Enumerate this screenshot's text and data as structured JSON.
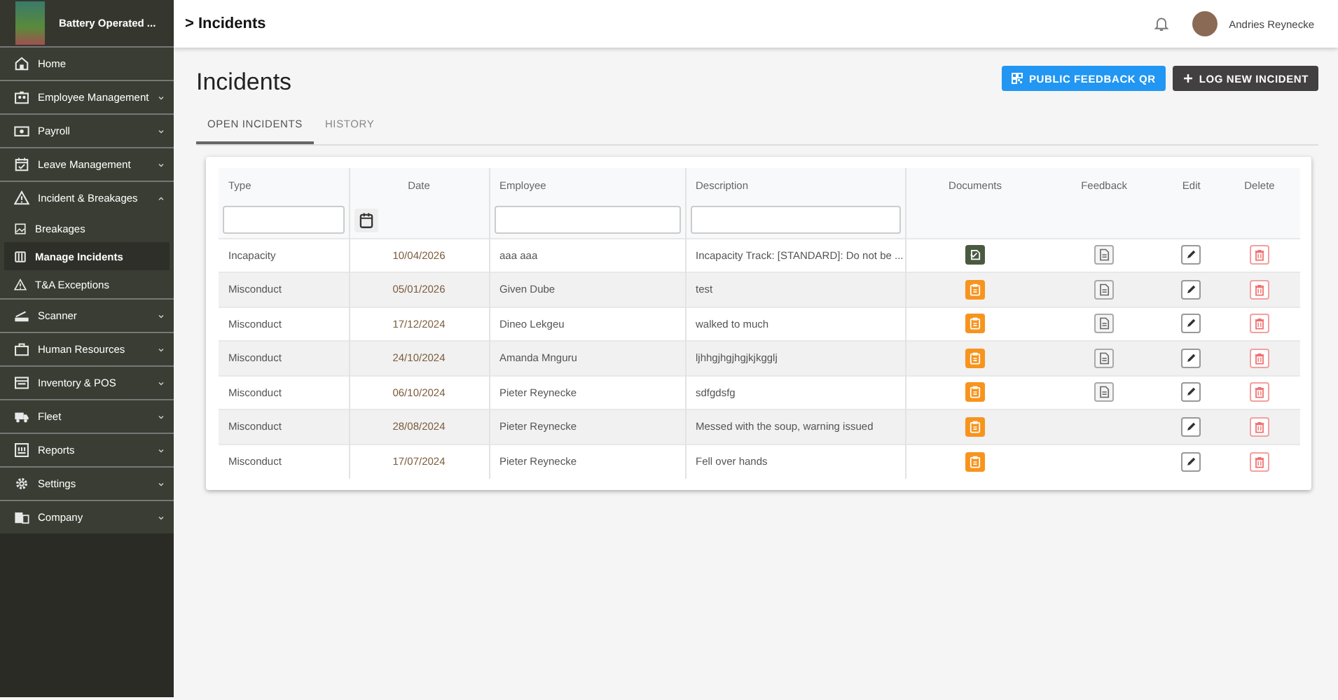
{
  "sidebar": {
    "company": "Battery Operated ...",
    "items": [
      {
        "label": "Home",
        "expandable": false,
        "selected": false
      },
      {
        "label": "Employee Management",
        "expandable": true,
        "expanded": false,
        "selected": false
      },
      {
        "label": "Payroll",
        "expandable": true,
        "expanded": false,
        "selected": false
      },
      {
        "label": "Leave Management",
        "expandable": true,
        "expanded": false,
        "selected": false
      },
      {
        "label": "Incident & Breakages",
        "expandable": true,
        "expanded": true,
        "selected": false,
        "children": [
          {
            "label": "Breakages",
            "selected": false
          },
          {
            "label": "Manage Incidents",
            "selected": true
          },
          {
            "label": "T&A Exceptions",
            "selected": false
          }
        ]
      },
      {
        "label": "Scanner",
        "expandable": true,
        "expanded": false,
        "selected": false
      },
      {
        "label": "Human Resources",
        "expandable": true,
        "expanded": false,
        "selected": false
      },
      {
        "label": "Inventory & POS",
        "expandable": true,
        "expanded": false,
        "selected": false
      },
      {
        "label": "Fleet",
        "expandable": true,
        "expanded": false,
        "selected": false
      },
      {
        "label": "Reports",
        "expandable": true,
        "expanded": false,
        "selected": false
      },
      {
        "label": "Settings",
        "expandable": true,
        "expanded": false,
        "selected": false
      },
      {
        "label": "Company",
        "expandable": true,
        "expanded": false,
        "selected": false
      }
    ]
  },
  "header": {
    "breadcrumb": "> Incidents",
    "user": "Andries Reynecke"
  },
  "page": {
    "title": "Incidents",
    "buttons": [
      {
        "label": "PUBLIC FEEDBACK QR",
        "kind": "qr"
      },
      {
        "label": "LOG NEW INCIDENT",
        "kind": "add"
      }
    ],
    "tabs": [
      {
        "label": "OPEN INCIDENTS",
        "selected": true
      },
      {
        "label": "HISTORY",
        "selected": false
      }
    ]
  },
  "table": {
    "columns": [
      "Type",
      "Date",
      "Employee",
      "Description",
      "Documents",
      "Feedback",
      "Edit",
      "Delete"
    ],
    "rows": [
      {
        "type": "Incapacity",
        "date": "10/04/2026",
        "employee": "aaa aaa",
        "description": "Incapacity Track: [STANDARD]: Do not be ...",
        "kind": "generated",
        "has_feedback": true
      },
      {
        "type": "Misconduct",
        "date": "05/01/2026",
        "employee": "Given Dube",
        "description": "test",
        "kind": "upload",
        "has_feedback": true
      },
      {
        "type": "Misconduct",
        "date": "17/12/2024",
        "employee": "Dineo Lekgeu",
        "description": "walked to much",
        "kind": "upload",
        "has_feedback": true
      },
      {
        "type": "Misconduct",
        "date": "24/10/2024",
        "employee": "Amanda Mnguru",
        "description": "ljhhgjhgjhgjkjkgglj",
        "kind": "upload",
        "has_feedback": true
      },
      {
        "type": "Misconduct",
        "date": "06/10/2024",
        "employee": "Pieter Reynecke",
        "description": "sdfgdsfg",
        "kind": "upload",
        "has_feedback": true
      },
      {
        "type": "Misconduct",
        "date": "28/08/2024",
        "employee": "Pieter Reynecke",
        "description": "Messed with the soup, warning issued",
        "kind": "upload",
        "has_feedback": false
      },
      {
        "type": "Misconduct",
        "date": "17/07/2024",
        "employee": "Pieter Reynecke",
        "description": "Fell over hands",
        "kind": "upload",
        "has_feedback": false
      }
    ]
  }
}
